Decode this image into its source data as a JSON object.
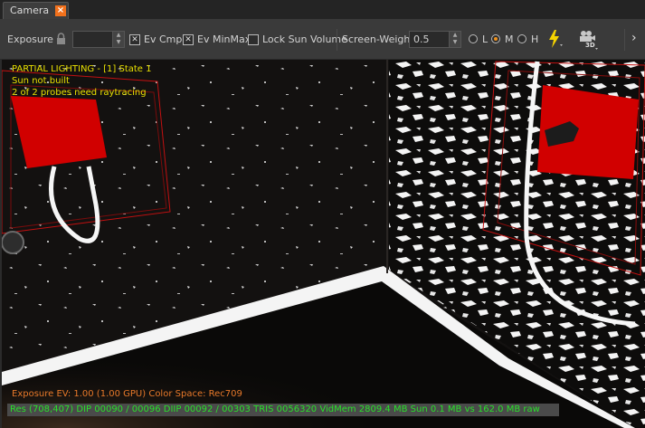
{
  "tab": {
    "label": "Camera",
    "close_glyph": "×"
  },
  "toolbar": {
    "exposure_label": "Exposure",
    "exposure_value": "",
    "ev_cmp_label": "Ev Cmp",
    "ev_cmp_checked": true,
    "ev_minmax_label": "Ev MinMax",
    "ev_minmax_checked": true,
    "lock_sun_label": "Lock Sun Volume",
    "lock_sun_checked": false,
    "screen_weight_label": "Screen-Weight",
    "screen_weight_value": "0.5",
    "quality": {
      "options": [
        "L",
        "M",
        "H"
      ],
      "selected": "M"
    },
    "icons": [
      "lock-icon",
      "lightning-icon",
      "camera-3d-icon",
      "chevron-right-icon"
    ],
    "camera_3d_label": "3D"
  },
  "overlay": {
    "status_lines": [
      "PARTIAL LIGHTING - [1] State 1",
      "Sun not built",
      "2 of 2 probes need raytracing"
    ],
    "exposure_line": "Exposure EV: 1.00 (1.00 GPU)   Color Space: Rec709",
    "stats_line": "Res (708,407)    DIP 00090 / 00096   DIIP 00092 / 00303   TRIS 0056320   VidMem 2809.4 MB   Sun 0.1 MB vs 162.0 MB raw"
  },
  "colors": {
    "accent": "#f2711c",
    "status_text": "#e8e000",
    "exposure_text": "#e8792a",
    "stats_text": "#29e02a",
    "probe": "#d10000"
  }
}
